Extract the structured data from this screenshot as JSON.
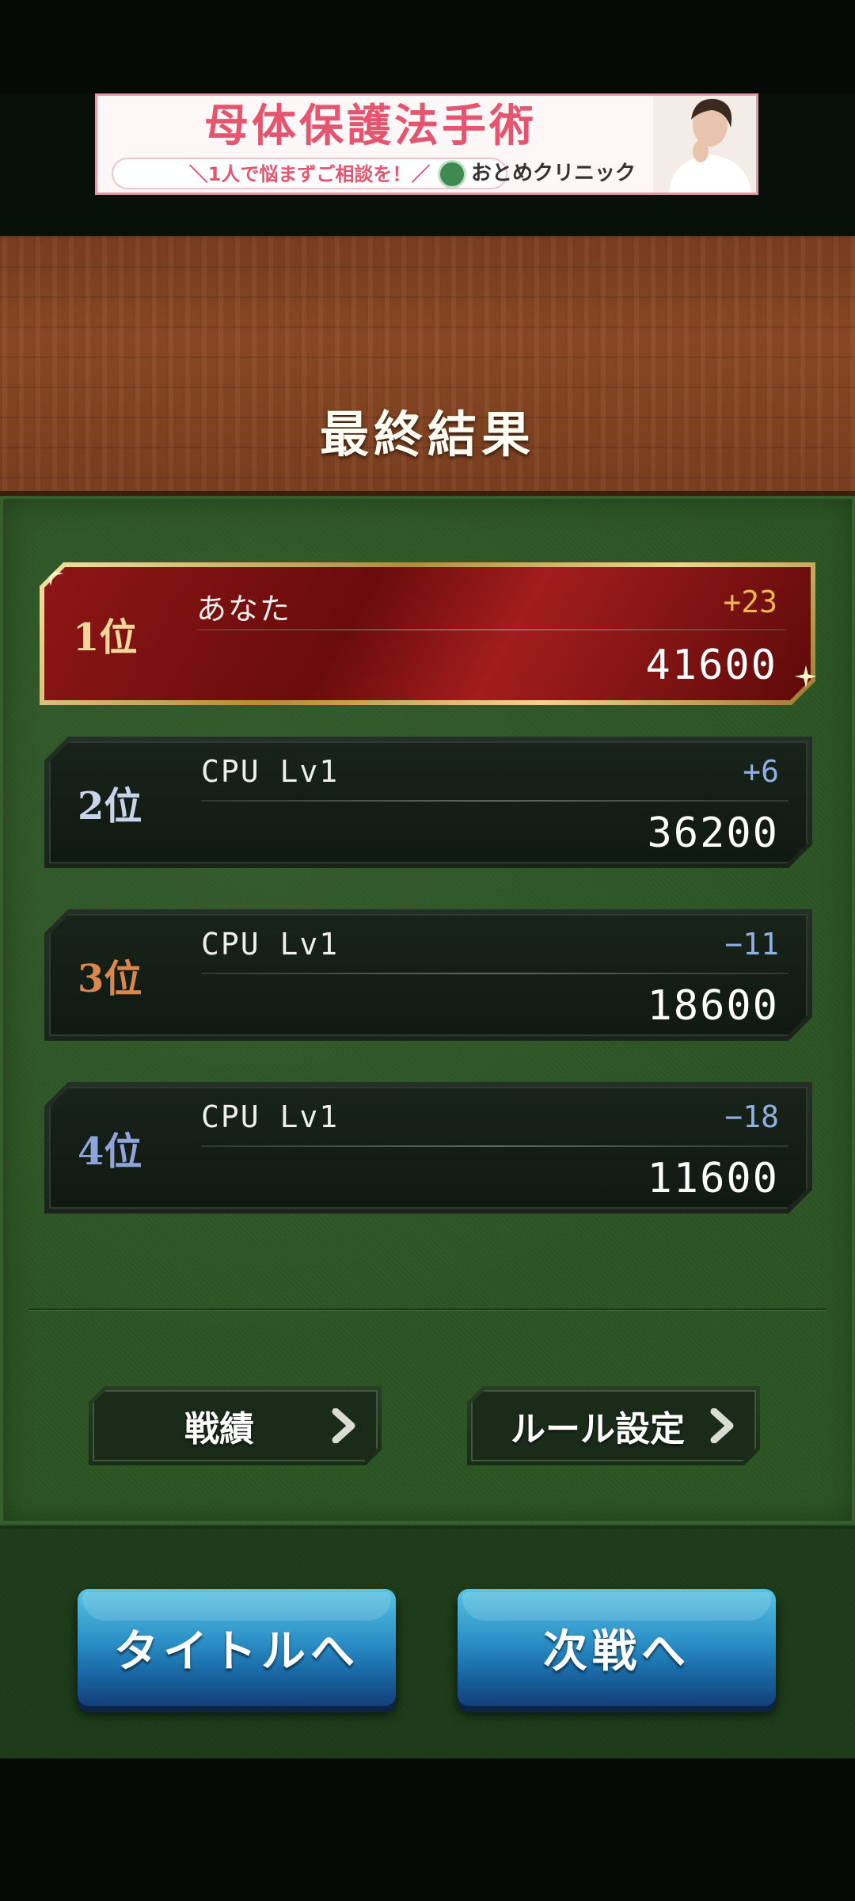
{
  "ad": {
    "headline": "母体保護法手術",
    "tagline": "＼1人で悩まずご相談を！／",
    "clinic": "おとめクリニック"
  },
  "screen": {
    "title": "最終結果"
  },
  "ranking": [
    {
      "rank": "1位",
      "name": "あなた",
      "diff": "+23",
      "score": "41600",
      "rank_color": "#f2d79a",
      "diff_color": "#f0b84a"
    },
    {
      "rank": "2位",
      "name": "CPU Lv1",
      "diff": "+6",
      "score": "36200",
      "rank_color": "#c8d4ea",
      "diff_color": "#8fb0e0"
    },
    {
      "rank": "3位",
      "name": "CPU Lv1",
      "diff": "−11",
      "score": "18600",
      "rank_color": "#d9884e",
      "diff_color": "#8fb0e0"
    },
    {
      "rank": "4位",
      "name": "CPU Lv1",
      "diff": "−18",
      "score": "11600",
      "rank_color": "#8fa4d8",
      "diff_color": "#8fb0e0"
    }
  ],
  "sub_buttons": {
    "record": "戦績",
    "rules": "ルール設定"
  },
  "main_buttons": {
    "title": "タイトルへ",
    "next": "次戦へ"
  },
  "colors": {
    "felt": "#2e5626",
    "wood": "#8c4a25",
    "button_blue": "#2b8fc6",
    "first_place_red": "#8e1616"
  }
}
